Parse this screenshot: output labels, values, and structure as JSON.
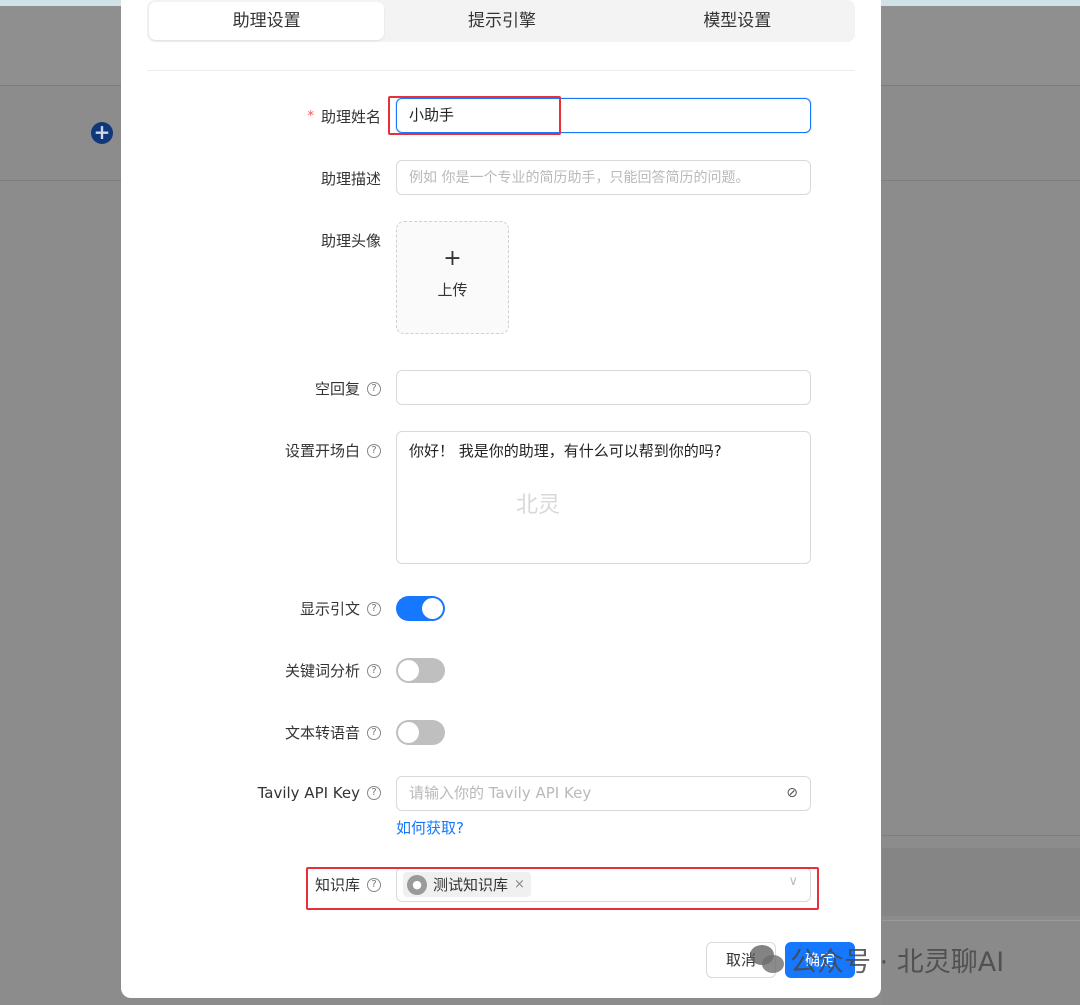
{
  "background": {
    "add_icon": "plus-circle-icon"
  },
  "tabs": [
    {
      "label": "助理设置",
      "active": true
    },
    {
      "label": "提示引擎",
      "active": false
    },
    {
      "label": "模型设置",
      "active": false
    }
  ],
  "form": {
    "name": {
      "required_mark": "*",
      "label": "助理姓名",
      "value": "小助手"
    },
    "description": {
      "label": "助理描述",
      "placeholder": "例如 你是一个专业的简历助手，只能回答简历的问题。"
    },
    "avatar": {
      "label": "助理头像",
      "plus": "+",
      "upload_text": "上传"
    },
    "empty_reply": {
      "label": "空回复",
      "value": ""
    },
    "opening": {
      "label": "设置开场白",
      "value": "你好！ 我是你的助理，有什么可以帮到你的吗?"
    },
    "show_citation": {
      "label": "显示引文",
      "on": true
    },
    "keyword_analysis": {
      "label": "关键词分析",
      "on": false
    },
    "tts": {
      "label": "文本转语音",
      "on": false
    },
    "tavily": {
      "label": "Tavily API Key",
      "placeholder": "请输入你的 Tavily API Key",
      "help_link": "如何获取?"
    },
    "knowledge_base": {
      "label": "知识库",
      "selected": "测试知识库",
      "close": "×",
      "chevron": "∨"
    }
  },
  "help_icon_glyph": "?",
  "buttons": {
    "cancel": "取消",
    "ok": "确定"
  },
  "watermarks": {
    "inner": "北灵",
    "overlay": "公众号 · 北灵聊AI"
  },
  "colors": {
    "primary": "#1677ff",
    "highlight": "#e8303a",
    "required": "#ff4d4f"
  }
}
